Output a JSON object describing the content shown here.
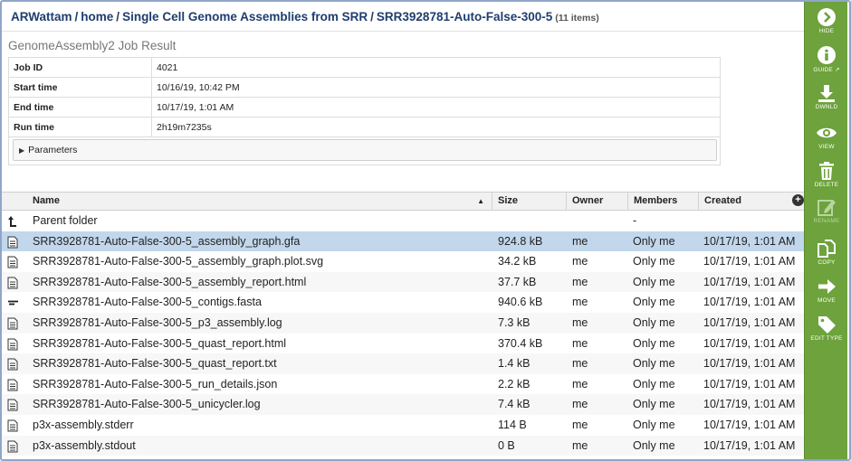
{
  "breadcrumb": {
    "items": [
      "ARWattam",
      "home",
      "Single Cell Genome Assemblies from SRR"
    ],
    "separator": "/",
    "current": "SRR3928781-Auto-False-300-5",
    "count": "(11 items)"
  },
  "job": {
    "title": "GenomeAssembly2 Job Result",
    "fields": [
      {
        "label": "Job ID",
        "value": "4021"
      },
      {
        "label": "Start time",
        "value": "10/16/19, 10:42 PM"
      },
      {
        "label": "End time",
        "value": "10/17/19, 1:01 AM"
      },
      {
        "label": "Run time",
        "value": "2h19m7235s"
      }
    ],
    "parameters_label": "Parameters"
  },
  "grid": {
    "columns": {
      "name": "Name",
      "size": "Size",
      "owner": "Owner",
      "members": "Members",
      "created": "Created"
    },
    "parent_folder": {
      "name": "Parent folder",
      "members": "-"
    },
    "rows": [
      {
        "icon": "document-icon",
        "name": "SRR3928781-Auto-False-300-5_assembly_graph.gfa",
        "size": "924.8 kB",
        "owner": "me",
        "members": "Only me",
        "created": "10/17/19, 1:01 AM"
      },
      {
        "icon": "document-icon",
        "name": "SRR3928781-Auto-False-300-5_assembly_graph.plot.svg",
        "size": "34.2 kB",
        "owner": "me",
        "members": "Only me",
        "created": "10/17/19, 1:01 AM"
      },
      {
        "icon": "document-icon",
        "name": "SRR3928781-Auto-False-300-5_assembly_report.html",
        "size": "37.7 kB",
        "owner": "me",
        "members": "Only me",
        "created": "10/17/19, 1:01 AM"
      },
      {
        "icon": "contigs-icon",
        "name": "SRR3928781-Auto-False-300-5_contigs.fasta",
        "size": "940.6 kB",
        "owner": "me",
        "members": "Only me",
        "created": "10/17/19, 1:01 AM"
      },
      {
        "icon": "document-icon",
        "name": "SRR3928781-Auto-False-300-5_p3_assembly.log",
        "size": "7.3 kB",
        "owner": "me",
        "members": "Only me",
        "created": "10/17/19, 1:01 AM"
      },
      {
        "icon": "document-icon",
        "name": "SRR3928781-Auto-False-300-5_quast_report.html",
        "size": "370.4 kB",
        "owner": "me",
        "members": "Only me",
        "created": "10/17/19, 1:01 AM"
      },
      {
        "icon": "document-icon",
        "name": "SRR3928781-Auto-False-300-5_quast_report.txt",
        "size": "1.4 kB",
        "owner": "me",
        "members": "Only me",
        "created": "10/17/19, 1:01 AM"
      },
      {
        "icon": "document-icon",
        "name": "SRR3928781-Auto-False-300-5_run_details.json",
        "size": "2.2 kB",
        "owner": "me",
        "members": "Only me",
        "created": "10/17/19, 1:01 AM"
      },
      {
        "icon": "document-icon",
        "name": "SRR3928781-Auto-False-300-5_unicycler.log",
        "size": "7.4 kB",
        "owner": "me",
        "members": "Only me",
        "created": "10/17/19, 1:01 AM"
      },
      {
        "icon": "document-icon",
        "name": "p3x-assembly.stderr",
        "size": "114 B",
        "owner": "me",
        "members": "Only me",
        "created": "10/17/19, 1:01 AM"
      },
      {
        "icon": "document-icon",
        "name": "p3x-assembly.stdout",
        "size": "0 B",
        "owner": "me",
        "members": "Only me",
        "created": "10/17/19, 1:01 AM"
      }
    ]
  },
  "sidebar": {
    "hide": "HIDE",
    "guide": "GUIDE",
    "download": "DWNLD",
    "view": "VIEW",
    "delete": "DELETE",
    "rename": "RENAME",
    "copy": "COPY",
    "move": "MOVE",
    "edit_type": "EDIT TYPE"
  },
  "colors": {
    "sidebar_green": "#6da23c",
    "selected_row": "#c2d7ec",
    "breadcrumb_blue": "#1f3d6e"
  }
}
